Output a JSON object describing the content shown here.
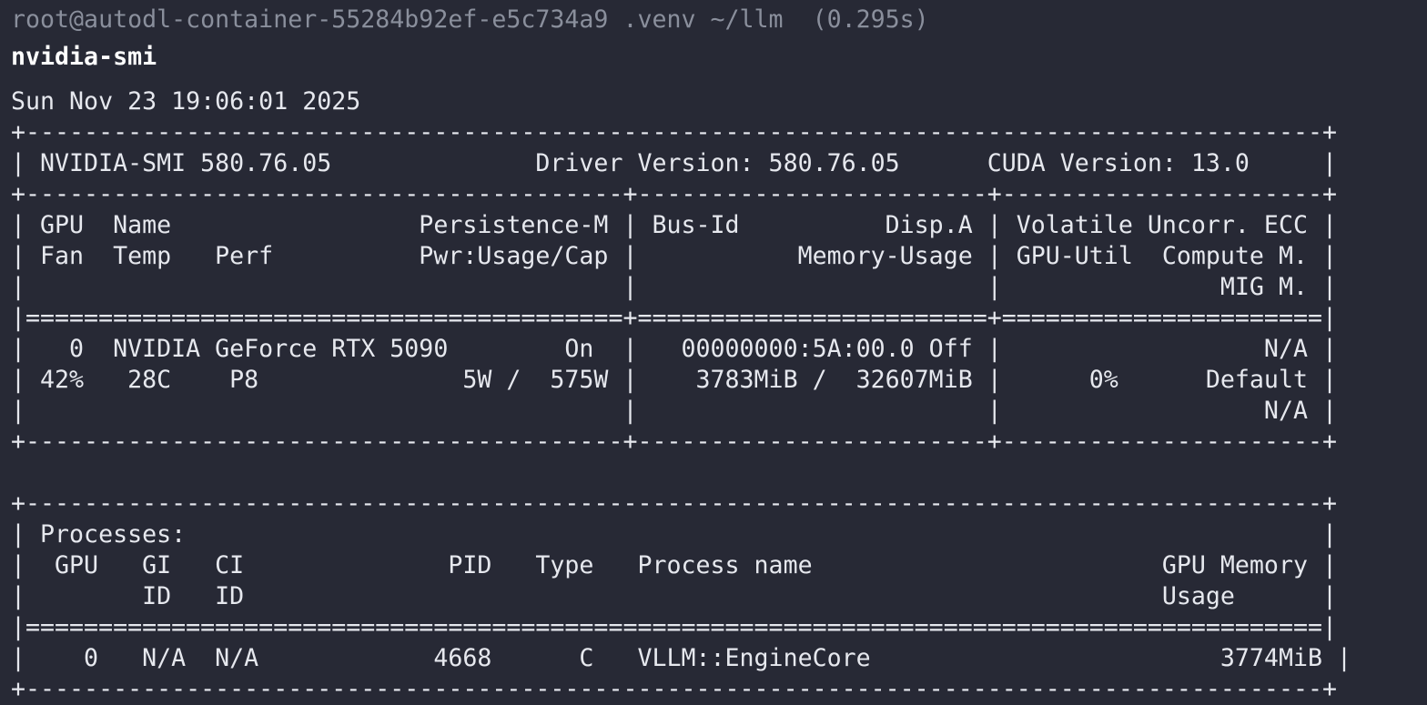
{
  "terminal": {
    "prompt": "root@autodl-container-55284b92ef-e5c734a9 .venv ~/llm  (0.295s)",
    "command": "nvidia-smi",
    "output_lines": [
      "Sun Nov 23 19:06:01 2025",
      "+-----------------------------------------------------------------------------------------+",
      "| NVIDIA-SMI 580.76.05              Driver Version: 580.76.05      CUDA Version: 13.0     |",
      "+-----------------------------------------+------------------------+----------------------+",
      "| GPU  Name                 Persistence-M | Bus-Id          Disp.A | Volatile Uncorr. ECC |",
      "| Fan  Temp   Perf          Pwr:Usage/Cap |           Memory-Usage | GPU-Util  Compute M. |",
      "|                                         |                        |               MIG M. |",
      "|=========================================+========================+======================|",
      "|   0  NVIDIA GeForce RTX 5090        On  |   00000000:5A:00.0 Off |                  N/A |",
      "| 42%   28C    P8              5W /  575W |    3783MiB /  32607MiB |      0%      Default |",
      "|                                         |                        |                  N/A |",
      "+-----------------------------------------+------------------------+----------------------+",
      "",
      "+-----------------------------------------------------------------------------------------+",
      "| Processes:                                                                              |",
      "|  GPU   GI   CI              PID   Type   Process name                        GPU Memory |",
      "|        ID   ID                                                               Usage      |",
      "|=========================================================================================|",
      "|    0   N/A  N/A            4668      C   VLLM::EngineCore                        3774MiB |",
      "+-----------------------------------------------------------------------------------------+"
    ]
  }
}
